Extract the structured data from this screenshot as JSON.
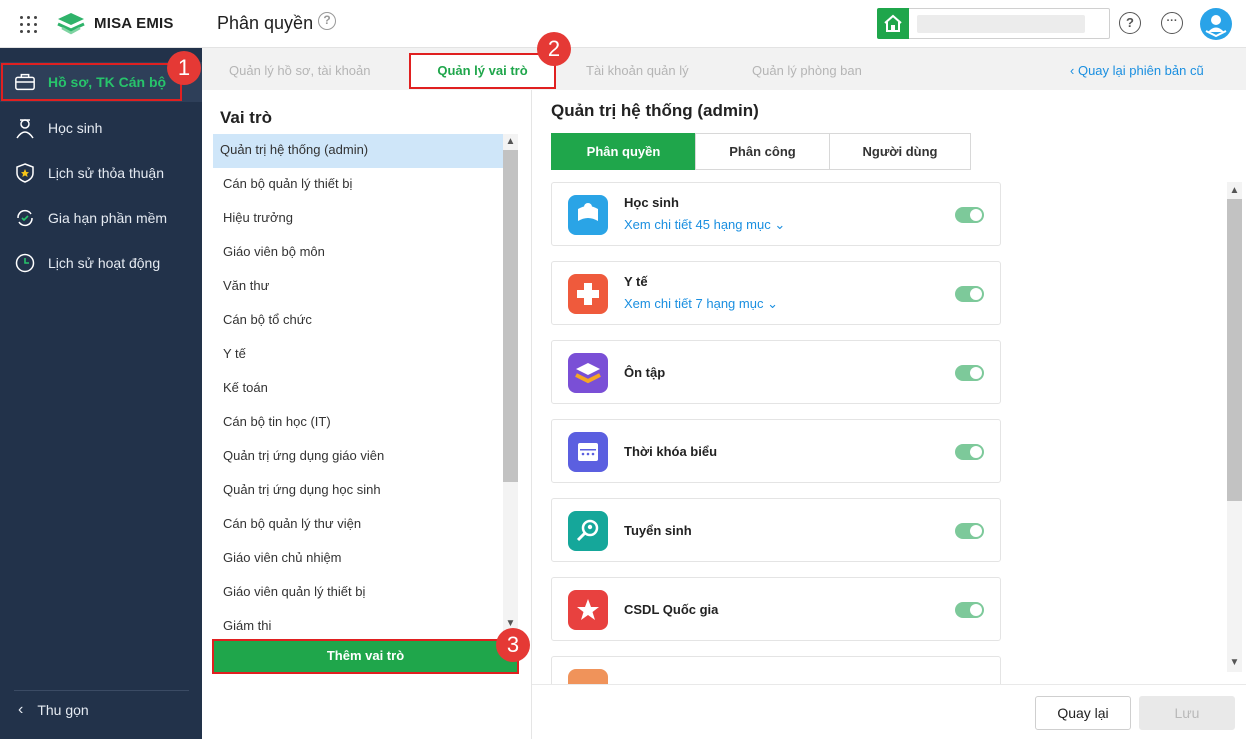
{
  "app": {
    "brand": "MISA EMIS",
    "page_title": "Phân quyền"
  },
  "sidebar": {
    "items": [
      {
        "label": "Hồ sơ, TK Cán bộ",
        "icon": "briefcase-icon",
        "active": true
      },
      {
        "label": "Học sinh",
        "icon": "student-icon"
      },
      {
        "label": "Lịch sử thỏa thuận",
        "icon": "shield-star-icon"
      },
      {
        "label": "Gia hạn phần mềm",
        "icon": "renew-icon"
      },
      {
        "label": "Lịch sử hoạt động",
        "icon": "clock-icon"
      }
    ],
    "collapse_label": "Thu gọn"
  },
  "tabs": [
    {
      "label": "Quản lý hồ sơ, tài khoản"
    },
    {
      "label": "Quản lý vai trò",
      "active": true
    },
    {
      "label": "Tài khoản quản lý"
    },
    {
      "label": "Quản lý phòng ban"
    }
  ],
  "back_link": "Quay lại phiên bản cũ",
  "roles": {
    "title": "Vai trò",
    "items": [
      "Quản trị hệ thống (admin)",
      "Cán bộ quản lý thiết bị",
      "Hiệu trưởng",
      "Giáo viên bộ môn",
      "Văn thư",
      "Cán bộ tổ chức",
      "Y tế",
      "Kế toán",
      "Cán bộ tin học (IT)",
      "Quản trị ứng dụng giáo viên",
      "Quản trị ứng dụng học sinh",
      "Cán bộ quản lý thư viện",
      "Giáo viên chủ nhiệm",
      "Giáo viên quản lý thiết bị",
      "Giám thi"
    ],
    "add_label": "Thêm vai trò"
  },
  "permissions": {
    "title": "Quản trị hệ thống (admin)",
    "segments": [
      "Phân quyền",
      "Phân công",
      "Người dùng"
    ],
    "modules": [
      {
        "name": "Học sinh",
        "detail": "Xem chi tiết 45 hạng mục",
        "color": "#2aa4e6"
      },
      {
        "name": "Y tế",
        "detail": "Xem chi tiết 7 hạng mục",
        "color": "#ef5a3c"
      },
      {
        "name": "Ôn tập",
        "detail": "",
        "color": "#7a4fd6"
      },
      {
        "name": "Thời khóa biểu",
        "detail": "",
        "color": "#5b5fe0"
      },
      {
        "name": "Tuyển sinh",
        "detail": "",
        "color": "#15a79a"
      },
      {
        "name": "CSDL Quốc gia",
        "detail": "",
        "color": "#e8413f"
      }
    ]
  },
  "footer": {
    "back_label": "Quay lại",
    "save_label": "Lưu"
  },
  "callouts": [
    "1",
    "2",
    "3"
  ]
}
